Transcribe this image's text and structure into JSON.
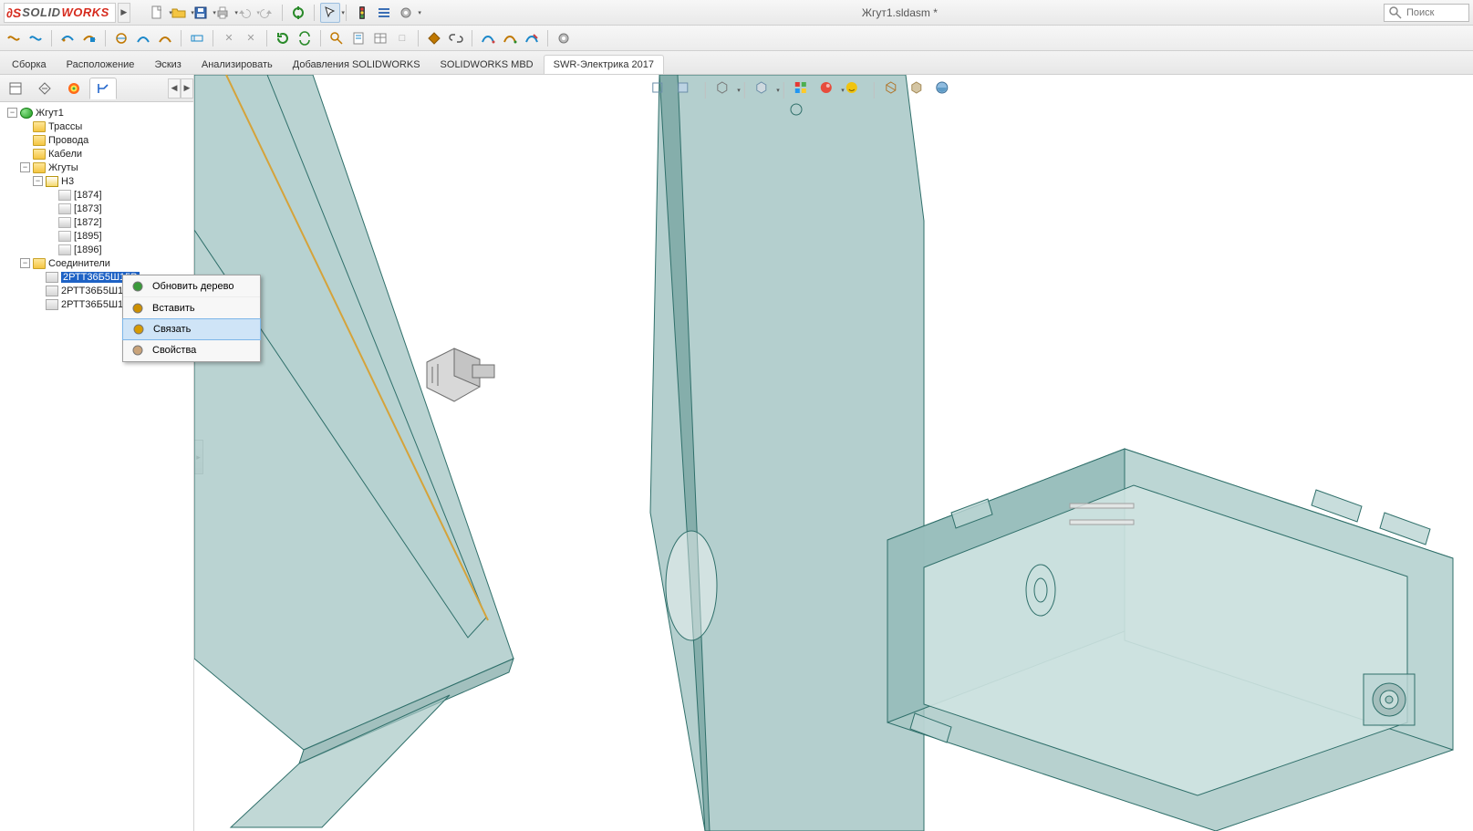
{
  "app": {
    "logo_solid": "SOLID",
    "logo_works": "WORKS",
    "doc_title": "Жгут1.sldasm *",
    "search_placeholder": "Поиск"
  },
  "cmd_tabs": [
    {
      "label": "Сборка",
      "active": false
    },
    {
      "label": "Расположение",
      "active": false
    },
    {
      "label": "Эскиз",
      "active": false
    },
    {
      "label": "Анализировать",
      "active": false
    },
    {
      "label": "Добавления SOLIDWORKS",
      "active": false
    },
    {
      "label": "SOLIDWORKS MBD",
      "active": false
    },
    {
      "label": "SWR-Электрика 2017",
      "active": true
    }
  ],
  "tree": {
    "root": "Жгут1",
    "folders": {
      "traces": "Трассы",
      "wires": "Провода",
      "cables": "Кабели",
      "harnesses": "Жгуты",
      "connectors": "Соединители"
    },
    "harness_name": "H3",
    "harness_items": [
      "[1874]",
      "[1873]",
      "[1872]",
      "[1895]",
      "[1896]"
    ],
    "connectors": [
      {
        "label": "2РТТ36Б5Ш15В",
        "selected": true
      },
      {
        "label": "2РТТ36Б5Ш1",
        "selected": false
      },
      {
        "label": "2РТТ36Б5Ш1",
        "selected": false
      }
    ]
  },
  "ctx": {
    "items": [
      {
        "label": "Обновить дерево",
        "iconColor": "#3a9a3a"
      },
      {
        "label": "Вставить",
        "iconColor": "#cc8f00"
      },
      {
        "label": "Связать",
        "iconColor": "#d79a00",
        "hover": true
      },
      {
        "label": "Свойства",
        "iconColor": "#c9a37a"
      }
    ]
  }
}
